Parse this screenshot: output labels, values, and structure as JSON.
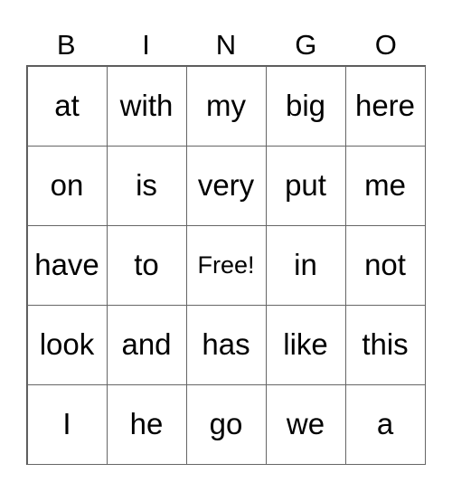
{
  "header": [
    "B",
    "I",
    "N",
    "G",
    "O"
  ],
  "rows": [
    [
      "at",
      "with",
      "my",
      "big",
      "here"
    ],
    [
      "on",
      "is",
      "very",
      "put",
      "me"
    ],
    [
      "have",
      "to",
      "Free!",
      "in",
      "not"
    ],
    [
      "look",
      "and",
      "has",
      "like",
      "this"
    ],
    [
      "I",
      "he",
      "go",
      "we",
      "a"
    ]
  ]
}
